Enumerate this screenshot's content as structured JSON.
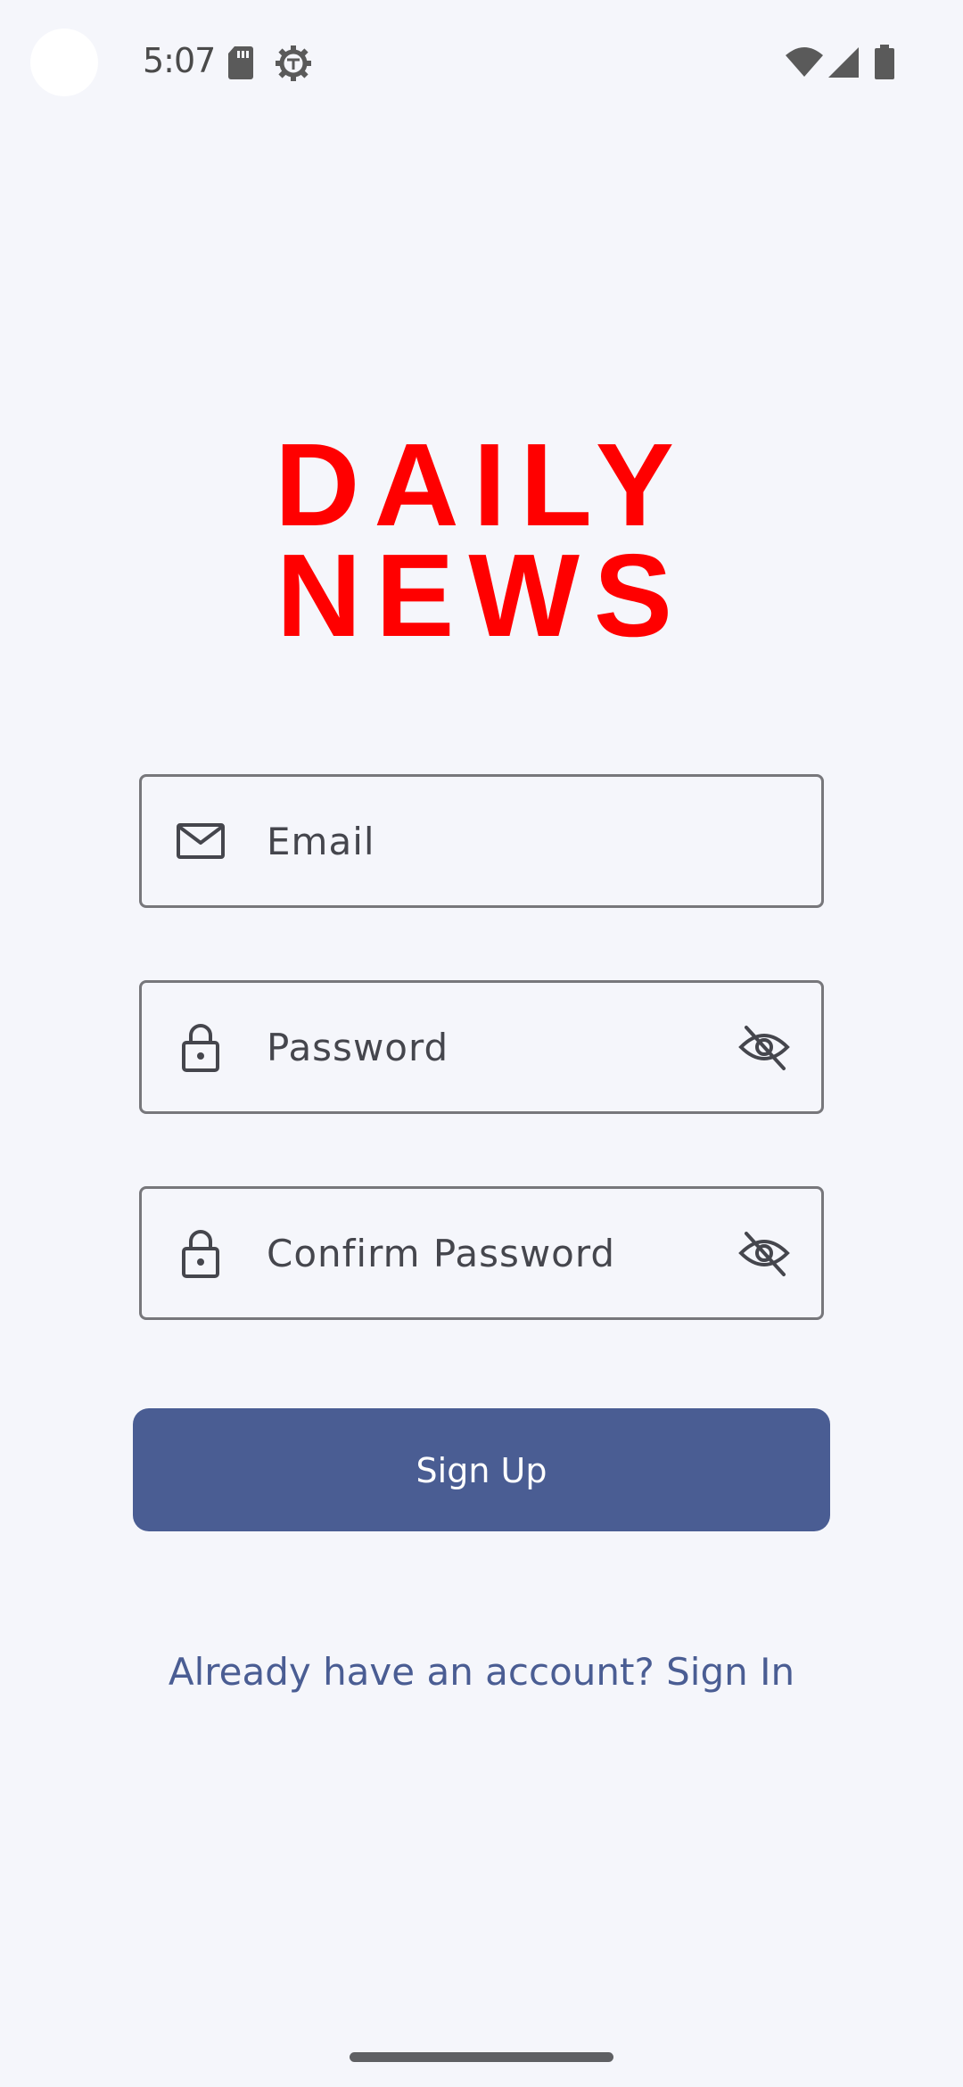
{
  "status_bar": {
    "time": "5:07",
    "icons": [
      "sd-card-icon",
      "settings-icon",
      "wifi-icon",
      "signal-icon",
      "battery-icon"
    ]
  },
  "logo": {
    "line1": "DAILY",
    "line2": "NEWS",
    "color": "#ff0000"
  },
  "form": {
    "email": {
      "placeholder": "Email",
      "value": "",
      "icon": "mail-icon"
    },
    "password": {
      "placeholder": "Password",
      "value": "",
      "icon": "lock-icon",
      "toggle_icon": "eye-off-icon"
    },
    "confirm_password": {
      "placeholder": "Confirm Password",
      "value": "",
      "icon": "lock-icon",
      "toggle_icon": "eye-off-icon"
    },
    "submit_label": "Sign Up"
  },
  "signin_link": "Already have an account? Sign In",
  "colors": {
    "background": "#f5f6fb",
    "primary": "#4a5d93",
    "field_border": "#77777b",
    "text": "#45464d"
  }
}
